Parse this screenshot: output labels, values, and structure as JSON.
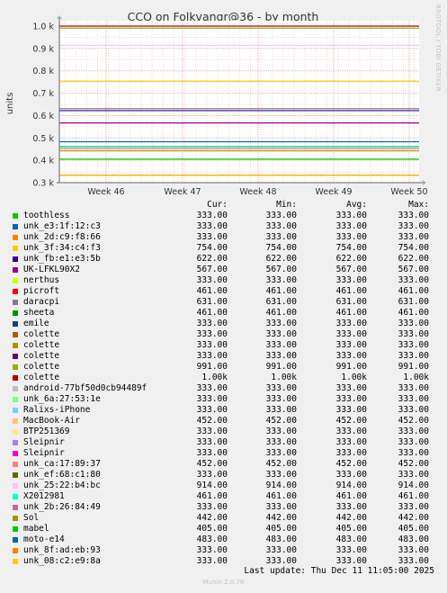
{
  "side_label": "RRDTOOL / TOBI OETIKER",
  "legend_columns": [
    "Cur:",
    "Min:",
    "Avg:",
    "Max:"
  ],
  "last_update": "Last update: Thu Dec 11 11:05:00 2025",
  "munin_version": "Munin 2.0.76",
  "chart_data": {
    "type": "line",
    "title": "CCQ on Folkvangr@36 - by month",
    "xlabel": "",
    "ylabel": "units",
    "x_ticks": [
      "Week 46",
      "Week 47",
      "Week 48",
      "Week 49",
      "Week 50"
    ],
    "y_ticks": [
      "0.3 k",
      "0.4 k",
      "0.5 k",
      "0.6 k",
      "0.7 k",
      "0.8 k",
      "0.9 k",
      "1.0 k"
    ],
    "ylim": [
      300,
      1030
    ],
    "grid": true,
    "series": [
      {
        "name": "toothless",
        "color": "#00cc00",
        "values": [
          333,
          333
        ],
        "cur": "333.00",
        "min": "333.00",
        "avg": "333.00",
        "max": "333.00"
      },
      {
        "name": "unk_e3:1f:12:c3",
        "color": "#0066b3",
        "values": [
          333,
          333
        ],
        "cur": "333.00",
        "min": "333.00",
        "avg": "333.00",
        "max": "333.00"
      },
      {
        "name": "unk_2d:c9:f8:66",
        "color": "#ff8000",
        "values": [
          333,
          333
        ],
        "cur": "333.00",
        "min": "333.00",
        "avg": "333.00",
        "max": "333.00"
      },
      {
        "name": "unk_3f:34:c4:f3",
        "color": "#ffcc00",
        "values": [
          754,
          754
        ],
        "cur": "754.00",
        "min": "754.00",
        "avg": "754.00",
        "max": "754.00"
      },
      {
        "name": "unk_fb:e1:e3:5b",
        "color": "#330099",
        "values": [
          622,
          622
        ],
        "cur": "622.00",
        "min": "622.00",
        "avg": "622.00",
        "max": "622.00"
      },
      {
        "name": "UK-LFKL90X2",
        "color": "#990099",
        "values": [
          567,
          567
        ],
        "cur": "567.00",
        "min": "567.00",
        "avg": "567.00",
        "max": "567.00"
      },
      {
        "name": "nerthus",
        "color": "#ccff00",
        "values": [
          333,
          333
        ],
        "cur": "333.00",
        "min": "333.00",
        "avg": "333.00",
        "max": "333.00"
      },
      {
        "name": "picroft",
        "color": "#ff0000",
        "values": [
          461,
          461
        ],
        "cur": "461.00",
        "min": "461.00",
        "avg": "461.00",
        "max": "461.00"
      },
      {
        "name": "daracpi",
        "color": "#808080",
        "values": [
          631,
          631
        ],
        "cur": "631.00",
        "min": "631.00",
        "avg": "631.00",
        "max": "631.00"
      },
      {
        "name": "sheeta",
        "color": "#008f00",
        "values": [
          461,
          461
        ],
        "cur": "461.00",
        "min": "461.00",
        "avg": "461.00",
        "max": "461.00"
      },
      {
        "name": "emile",
        "color": "#00487d",
        "values": [
          333,
          333
        ],
        "cur": "333.00",
        "min": "333.00",
        "avg": "333.00",
        "max": "333.00"
      },
      {
        "name": "colette",
        "color": "#b35a00",
        "values": [
          333,
          333
        ],
        "cur": "333.00",
        "min": "333.00",
        "avg": "333.00",
        "max": "333.00"
      },
      {
        "name": "colette",
        "color": "#b38f00",
        "values": [
          333,
          333
        ],
        "cur": "333.00",
        "min": "333.00",
        "avg": "333.00",
        "max": "333.00"
      },
      {
        "name": "colette",
        "color": "#6b006b",
        "values": [
          333,
          333
        ],
        "cur": "333.00",
        "min": "333.00",
        "avg": "333.00",
        "max": "333.00"
      },
      {
        "name": "colette",
        "color": "#8fb300",
        "values": [
          991,
          991
        ],
        "cur": "991.00",
        "min": "991.00",
        "avg": "991.00",
        "max": "991.00"
      },
      {
        "name": "colette",
        "color": "#b30000",
        "values": [
          1000,
          1000
        ],
        "cur": "1.00k",
        "min": "1.00k",
        "avg": "1.00k",
        "max": "1.00k"
      },
      {
        "name": "android-77bf50d0cb94489f",
        "color": "#bebebe",
        "values": [
          333,
          333
        ],
        "cur": "333.00",
        "min": "333.00",
        "avg": "333.00",
        "max": "333.00"
      },
      {
        "name": "unk_6a:27:53:1e",
        "color": "#80ff80",
        "values": [
          333,
          333
        ],
        "cur": "333.00",
        "min": "333.00",
        "avg": "333.00",
        "max": "333.00"
      },
      {
        "name": "Ralixs-iPhone",
        "color": "#80c9ff",
        "values": [
          333,
          333
        ],
        "cur": "333.00",
        "min": "333.00",
        "avg": "333.00",
        "max": "333.00"
      },
      {
        "name": "MacBook-Air",
        "color": "#ffc080",
        "values": [
          452,
          452
        ],
        "cur": "452.00",
        "min": "452.00",
        "avg": "452.00",
        "max": "452.00"
      },
      {
        "name": "BTP251369",
        "color": "#ffe680",
        "values": [
          333,
          333
        ],
        "cur": "333.00",
        "min": "333.00",
        "avg": "333.00",
        "max": "333.00"
      },
      {
        "name": "Sleipnir",
        "color": "#aa80ff",
        "values": [
          333,
          333
        ],
        "cur": "333.00",
        "min": "333.00",
        "avg": "333.00",
        "max": "333.00"
      },
      {
        "name": "Sleipnir",
        "color": "#ee00cc",
        "values": [
          333,
          333
        ],
        "cur": "333.00",
        "min": "333.00",
        "avg": "333.00",
        "max": "333.00"
      },
      {
        "name": "unk_ca:17:89:37",
        "color": "#ff8080",
        "values": [
          452,
          452
        ],
        "cur": "452.00",
        "min": "452.00",
        "avg": "452.00",
        "max": "452.00"
      },
      {
        "name": "unk_ef:68:c1:80",
        "color": "#666600",
        "values": [
          333,
          333
        ],
        "cur": "333.00",
        "min": "333.00",
        "avg": "333.00",
        "max": "333.00"
      },
      {
        "name": "unk_25:22:b4:bc",
        "color": "#ffbfff",
        "values": [
          914,
          914
        ],
        "cur": "914.00",
        "min": "914.00",
        "avg": "914.00",
        "max": "914.00"
      },
      {
        "name": "X2012981",
        "color": "#00ffcc",
        "values": [
          461,
          461
        ],
        "cur": "461.00",
        "min": "461.00",
        "avg": "461.00",
        "max": "461.00"
      },
      {
        "name": "unk_2b:26:84:49",
        "color": "#cc6699",
        "values": [
          333,
          333
        ],
        "cur": "333.00",
        "min": "333.00",
        "avg": "333.00",
        "max": "333.00"
      },
      {
        "name": "Sol",
        "color": "#999900",
        "values": [
          442,
          442
        ],
        "cur": "442.00",
        "min": "442.00",
        "avg": "442.00",
        "max": "442.00"
      },
      {
        "name": "mabel",
        "color": "#00cc00",
        "values": [
          405,
          405
        ],
        "cur": "405.00",
        "min": "405.00",
        "avg": "405.00",
        "max": "405.00"
      },
      {
        "name": "moto-e14",
        "color": "#0066b3",
        "values": [
          483,
          483
        ],
        "cur": "483.00",
        "min": "483.00",
        "avg": "483.00",
        "max": "483.00"
      },
      {
        "name": "unk_8f:ad:eb:93",
        "color": "#ff8000",
        "values": [
          333,
          333
        ],
        "cur": "333.00",
        "min": "333.00",
        "avg": "333.00",
        "max": "333.00"
      },
      {
        "name": "unk_08:c2:e9:8a",
        "color": "#ffcc00",
        "values": [
          333,
          333
        ],
        "cur": "333.00",
        "min": "333.00",
        "avg": "333.00",
        "max": "333.00"
      }
    ]
  }
}
